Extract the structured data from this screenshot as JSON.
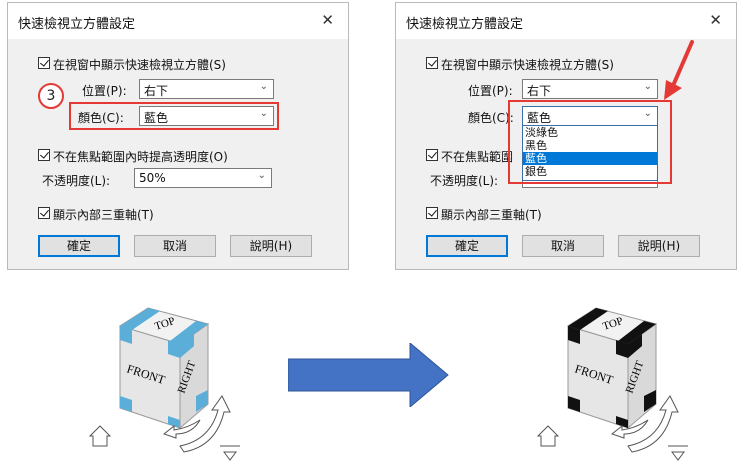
{
  "left_dialog": {
    "title": "快速檢視立方體設定",
    "close_icon": "close-icon",
    "show_in_window_label": "在視窗中顯示快速檢視立方體(S)",
    "position_label": "位置(P):",
    "position_value": "右下",
    "color_label": "顏色(C):",
    "color_value": "藍色",
    "step_number": "3",
    "raise_opacity_label": "不在焦點範圍內時提高透明度(O)",
    "opacity_label": "不透明度(L):",
    "opacity_value": "50%",
    "show_triad_label": "顯示內部三重軸(T)",
    "ok_label": "確定",
    "cancel_label": "取消",
    "help_label": "說明(H)"
  },
  "right_dialog": {
    "title": "快速檢視立方體設定",
    "close_icon": "close-icon",
    "show_in_window_label": "在視窗中顯示快速檢視立方體(S)",
    "position_label": "位置(P):",
    "position_value": "右下",
    "color_label": "顏色(C):",
    "color_value": "藍色",
    "color_options": [
      "淡綠色",
      "黑色",
      "藍色",
      "銀色"
    ],
    "selected_option_index": 2,
    "raise_opacity_label": "不在焦點範圍",
    "opacity_label": "不透明度(L):",
    "show_triad_label": "顯示內部三重軸(T)",
    "ok_label": "確定",
    "cancel_label": "取消",
    "help_label": "說明(H)"
  },
  "cubes": {
    "left": {
      "top": "TOP",
      "front": "FRONT",
      "right": "RIGHT",
      "corner_color": "#5aaed8"
    },
    "right": {
      "top": "TOP",
      "front": "FRONT",
      "right": "RIGHT",
      "corner_color": "#111111"
    }
  },
  "colors": {
    "highlight_red": "#e53935",
    "arrow_blue": "#4472c4",
    "selection_blue": "#0078d7"
  }
}
